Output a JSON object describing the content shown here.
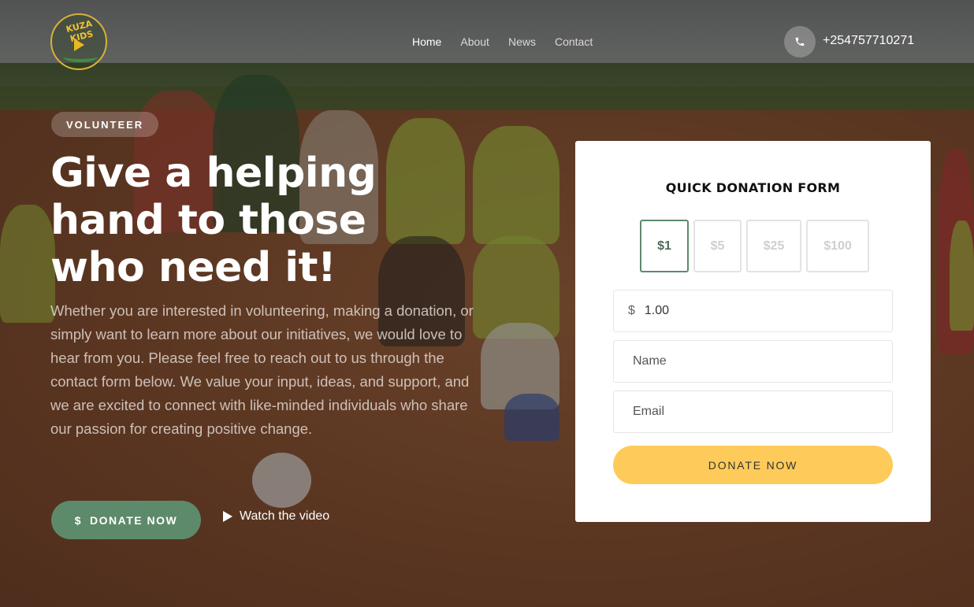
{
  "header": {
    "logo_text": "KUZA KIDS",
    "nav": [
      {
        "label": "Home",
        "active": true
      },
      {
        "label": "About",
        "active": false
      },
      {
        "label": "News",
        "active": false
      },
      {
        "label": "Contact",
        "active": false
      }
    ],
    "phone_icon": "phone-icon",
    "phone": "+254757710271"
  },
  "hero": {
    "tag": "VOLUNTEER",
    "headline": "Give a helping hand to those who need it!",
    "description": "Whether you are interested in volunteering, making a donation, or simply want to learn more about our initiatives, we would love to hear from you. Please feel free to reach out to us through the contact form below. We value your input, ideas, and support, and we are excited to connect with like-minded individuals who share our passion for creating positive change.",
    "donate_icon": "$",
    "donate_label": "DONATE NOW",
    "watch_label": "Watch the video"
  },
  "form": {
    "title": "QUICK DONATION FORM",
    "amounts": [
      "$1",
      "$5",
      "$25",
      "$100"
    ],
    "selected_amount": "$1",
    "currency_symbol": "$",
    "amount_value": "1.00",
    "name_placeholder": "Name",
    "email_placeholder": "Email",
    "submit_label": "DONATE NOW"
  },
  "colors": {
    "primary_green": "#5d8a6a",
    "accent_yellow": "#fecb5a",
    "logo_gold": "#f2c230"
  }
}
